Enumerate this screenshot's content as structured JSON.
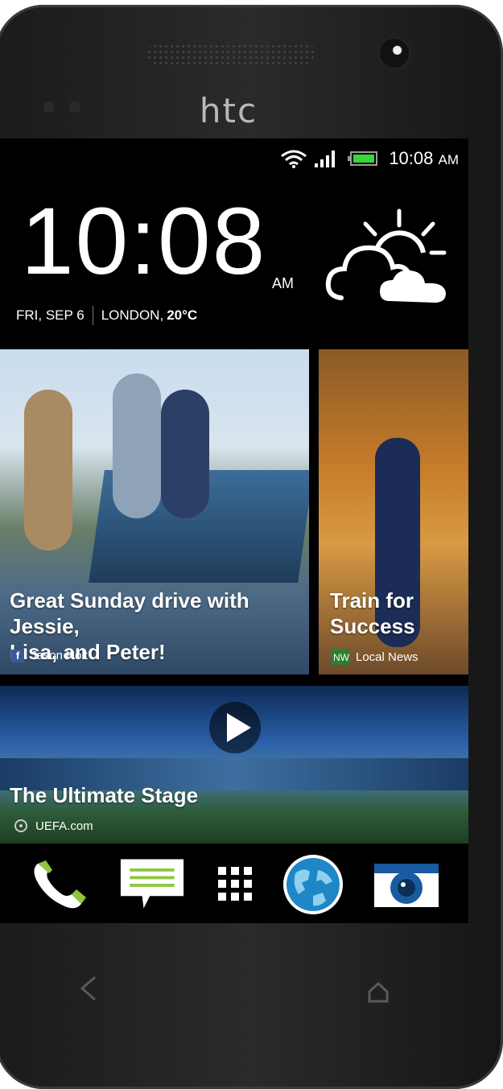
{
  "device": {
    "brand": "htc"
  },
  "status_bar": {
    "time": "10:08",
    "ampm": "AM"
  },
  "clock_widget": {
    "time": "10:08",
    "ampm": "AM",
    "date": "FRI, SEP 6",
    "location": "LONDON,",
    "temperature": "20°C"
  },
  "feed": [
    {
      "title_line1": "Great Sunday drive with Jessie,",
      "title_line2": "Lisa, and Peter!",
      "source": "Jason Holt",
      "source_icon": "facebook-icon"
    },
    {
      "title_line1": "Train for",
      "title_line2": "Success",
      "source": "Local News",
      "source_icon": "news-icon"
    },
    {
      "title": "The Ultimate Stage",
      "source": "UEFA.com",
      "source_icon": "uefa-icon"
    }
  ],
  "dock": [
    "phone-icon",
    "messages-icon",
    "apps-icon",
    "browser-icon",
    "camera-icon"
  ],
  "colors": {
    "accent_green": "#8ec63f",
    "fb_blue": "#3b5998",
    "browser_blue": "#1f86c7",
    "camera_blue": "#1a5aa0"
  }
}
